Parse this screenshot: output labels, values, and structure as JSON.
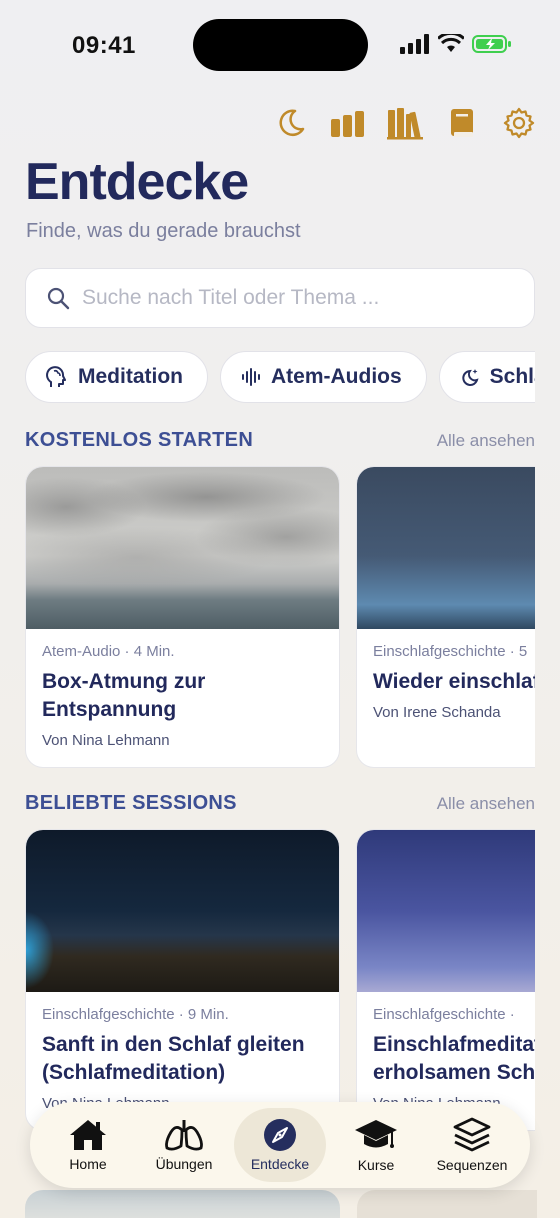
{
  "status_bar": {
    "time": "09:41"
  },
  "header": {
    "title": "Entdecke",
    "subtitle": "Finde, was du gerade brauchst"
  },
  "search": {
    "placeholder": "Suche nach Titel oder Thema ..."
  },
  "chips": [
    {
      "label": "Meditation",
      "icon": "brain-icon"
    },
    {
      "label": "Atem-Audios",
      "icon": "waveform-icon"
    },
    {
      "label": "Schlaf",
      "icon": "moon-stars-icon"
    }
  ],
  "sections": [
    {
      "title": "KOSTENLOS STARTEN",
      "link": "Alle ansehen",
      "cards": [
        {
          "meta": "Atem-Audio · 4 Min.",
          "title_line1": "Box-Atmung zur",
          "title_line2": "Entspannung",
          "author": "Von Nina Lehmann"
        },
        {
          "meta": "Einschlafgeschichte · 5",
          "title_line1": "Wieder einschlaf",
          "title_line2": "",
          "author": "Von Irene Schanda"
        }
      ]
    },
    {
      "title": "BELIEBTE SESSIONS",
      "link": "Alle ansehen",
      "cards": [
        {
          "meta": "Einschlafgeschichte · 9 Min.",
          "title_line1": "Sanft in den Schlaf gleiten",
          "title_line2": "(Schlafmeditation)",
          "author": "Von Nina Lehmann"
        },
        {
          "meta": "Einschlafgeschichte ·",
          "title_line1": "Einschlafmeditat",
          "title_line2": "erholsamen Schl",
          "author": "Von Nina Lehmann"
        }
      ]
    }
  ],
  "bottom_nav": [
    {
      "label": "Home",
      "icon": "house-icon",
      "active": false
    },
    {
      "label": "Übungen",
      "icon": "lungs-icon",
      "active": false
    },
    {
      "label": "Entdecke",
      "icon": "compass-icon",
      "active": true
    },
    {
      "label": "Kurse",
      "icon": "graduation-cap-icon",
      "active": false
    },
    {
      "label": "Sequenzen",
      "icon": "layers-icon",
      "active": false
    }
  ],
  "colors": {
    "accent_gold": "#c08a2a",
    "title_navy": "#22295c",
    "section_blue": "#3d4f94",
    "battery_green": "#3fcf4f"
  }
}
